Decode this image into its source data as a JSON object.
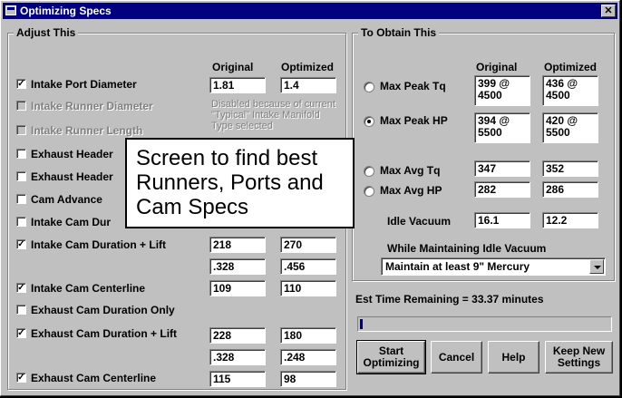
{
  "window": {
    "title": "Optimizing Specs"
  },
  "adjust": {
    "group_label": "Adjust This",
    "col_original": "Original",
    "col_optimized": "Optimized",
    "rows": {
      "intake_port_diameter": {
        "label": "Intake Port Diameter",
        "checked": true,
        "original": "1.81",
        "optimized": "1.4"
      },
      "intake_runner_diameter": {
        "label": "Intake Runner Diameter"
      },
      "intake_runner_length": {
        "label": "Intake Runner Length"
      },
      "exhaust_header_1": {
        "label": "Exhaust Header"
      },
      "exhaust_header_2": {
        "label": "Exhaust Header"
      },
      "cam_advance": {
        "label": "Cam Advance"
      },
      "intake_cam_dur": {
        "label": "Intake Cam Dur"
      },
      "intake_cam_duration_lift": {
        "label": "Intake Cam Duration + Lift",
        "checked": true,
        "original": "218",
        "optimized": "270",
        "original_lift": ".328",
        "optimized_lift": ".456"
      },
      "intake_cam_centerline": {
        "label": "Intake Cam Centerline",
        "checked": true,
        "original": "109",
        "optimized": "110"
      },
      "exhaust_cam_duration_only": {
        "label": "Exhaust Cam Duration Only"
      },
      "exhaust_cam_duration_lift": {
        "label": "Exhaust Cam Duration + Lift",
        "checked": true,
        "original": "228",
        "optimized": "180",
        "original_lift": ".328",
        "optimized_lift": ".248"
      },
      "exhaust_cam_centerline": {
        "label": "Exhaust Cam Centerline",
        "checked": true,
        "original": "115",
        "optimized": "98"
      }
    },
    "disabled_note_1": "Disabled because of current",
    "disabled_note_2": "\"Typical\" Intake Manifold",
    "disabled_note_3": "Type selected"
  },
  "obtain": {
    "group_label": "To Obtain This",
    "col_original": "Original",
    "col_optimized": "Optimized",
    "max_peak_tq": {
      "label": "Max Peak Tq",
      "original": "399 @\n4500",
      "optimized": "436 @\n4500"
    },
    "max_peak_hp": {
      "label": "Max Peak HP",
      "selected": true,
      "original": "394 @\n5500",
      "optimized": "420 @\n5500"
    },
    "max_avg_tq": {
      "label": "Max Avg Tq",
      "original": "347",
      "optimized": "352"
    },
    "max_avg_hp": {
      "label": "Max Avg HP",
      "original": "282",
      "optimized": "286"
    },
    "idle_vacuum": {
      "label": "Idle Vacuum",
      "original": "16.1",
      "optimized": "12.2"
    },
    "maintain_label": "While Maintaining Idle Vacuum",
    "maintain_selected": "Maintain at least 9\" Mercury"
  },
  "status": {
    "time_remaining": "Est Time Remaining = 33.37 minutes",
    "progress": 0.01
  },
  "buttons": {
    "start": "Start\nOptimizing",
    "cancel": "Cancel",
    "help": "Help",
    "keep": "Keep New\nSettings"
  },
  "overlay": {
    "text": "Screen to find best Runners, Ports and Cam Specs"
  }
}
